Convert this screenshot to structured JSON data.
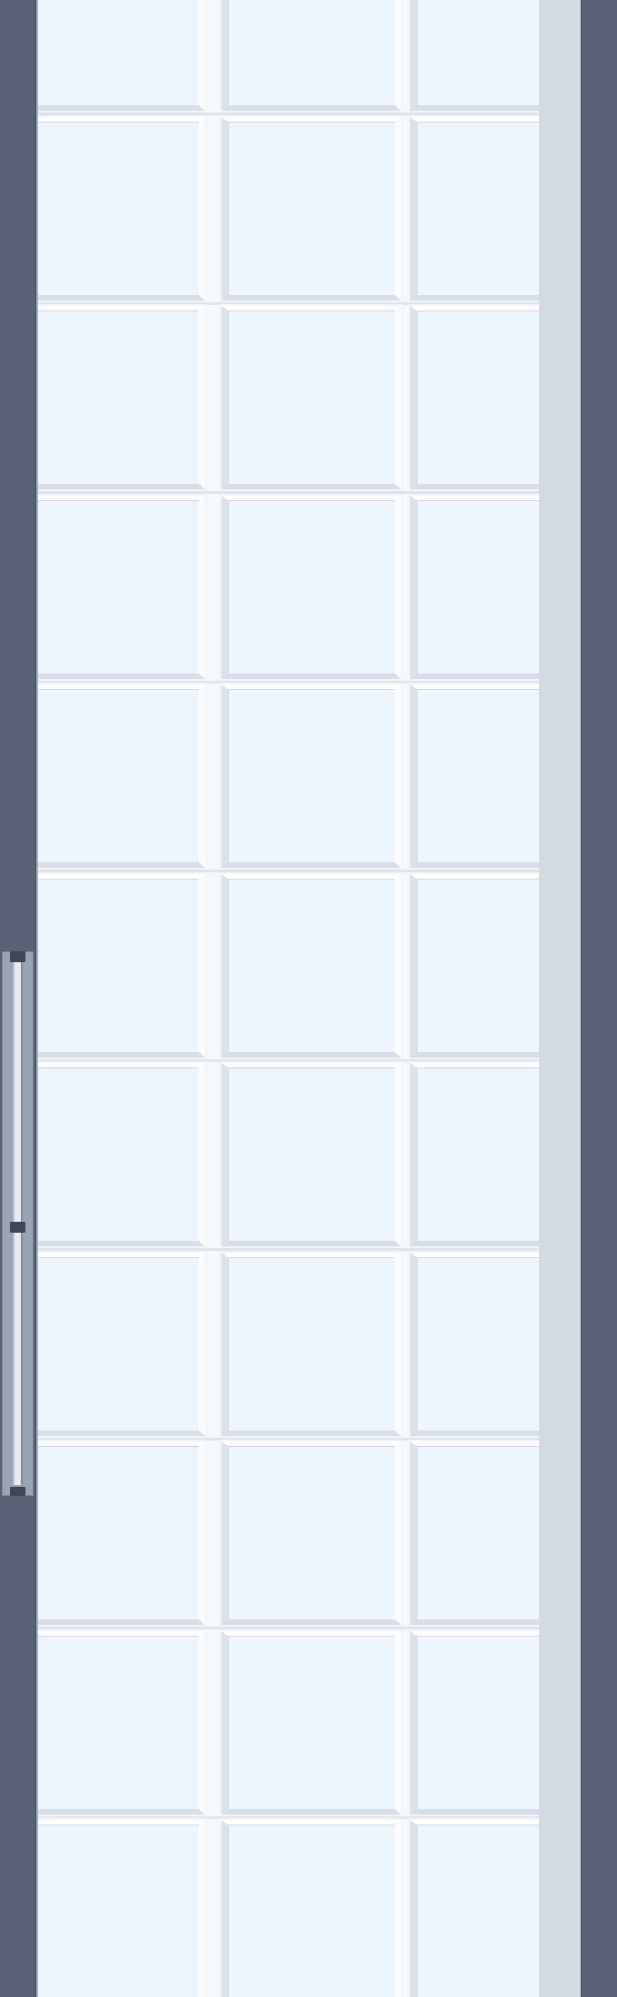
{
  "colors": {
    "frame": "#576276",
    "glass": "#edf5fd",
    "muntin": "#f6f9fc",
    "shade": "#787d87",
    "handle_cap": "#3e4656",
    "handle_plate": "#9aa3b3"
  },
  "grid": {
    "columns": 3,
    "rows": 11
  },
  "icons": {
    "handle": "door-handle-icon"
  }
}
